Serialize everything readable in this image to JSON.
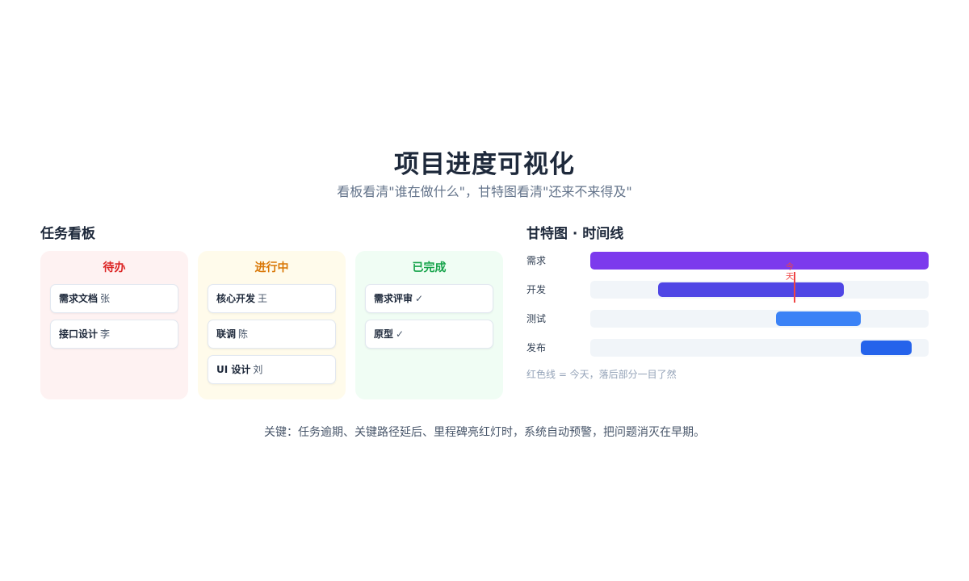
{
  "header": {
    "title": "项目进度可视化",
    "subtitle": "看板看清\"谁在做什么\"，甘特图看清\"还来不来得及\""
  },
  "kanban": {
    "title": "任务看板",
    "columns": [
      {
        "label": "待办",
        "color": "#dc2626",
        "background": "#fef2f2",
        "cards": [
          {
            "name": "需求文档",
            "owner": "张"
          },
          {
            "name": "接口设计",
            "owner": "李"
          }
        ]
      },
      {
        "label": "进行中",
        "color": "#d97706",
        "background": "#fffbeb",
        "cards": [
          {
            "name": "核心开发",
            "owner": "王"
          },
          {
            "name": "联调",
            "owner": "陈"
          },
          {
            "name": "UI 设计",
            "owner": "刘"
          }
        ]
      },
      {
        "label": "已完成",
        "color": "#16a34a",
        "background": "#f0fdf4",
        "cards": [
          {
            "name": "需求评审",
            "owner": "✓"
          },
          {
            "name": "原型",
            "owner": "✓"
          }
        ]
      }
    ]
  },
  "gantt": {
    "title": "甘特图 · 时间线",
    "tasks": [
      {
        "label": "需求",
        "start": 0.0,
        "end": 1.0,
        "color": "#7c3aed"
      },
      {
        "label": "开发",
        "start": 0.2,
        "end": 0.75,
        "color": "#4f46e5"
      },
      {
        "label": "测试",
        "start": 0.55,
        "end": 0.8,
        "color": "#3b82f6"
      },
      {
        "label": "发布",
        "start": 0.8,
        "end": 0.95,
        "color": "#2563eb"
      }
    ],
    "today_label": "今天",
    "today_color": "#ef4444",
    "note": "红色线 = 今天，落后部分一目了然"
  },
  "footer": "关键：任务逾期、关键路径延后、里程碑亮红灯时，系统自动预警，把问题消灭在早期。"
}
